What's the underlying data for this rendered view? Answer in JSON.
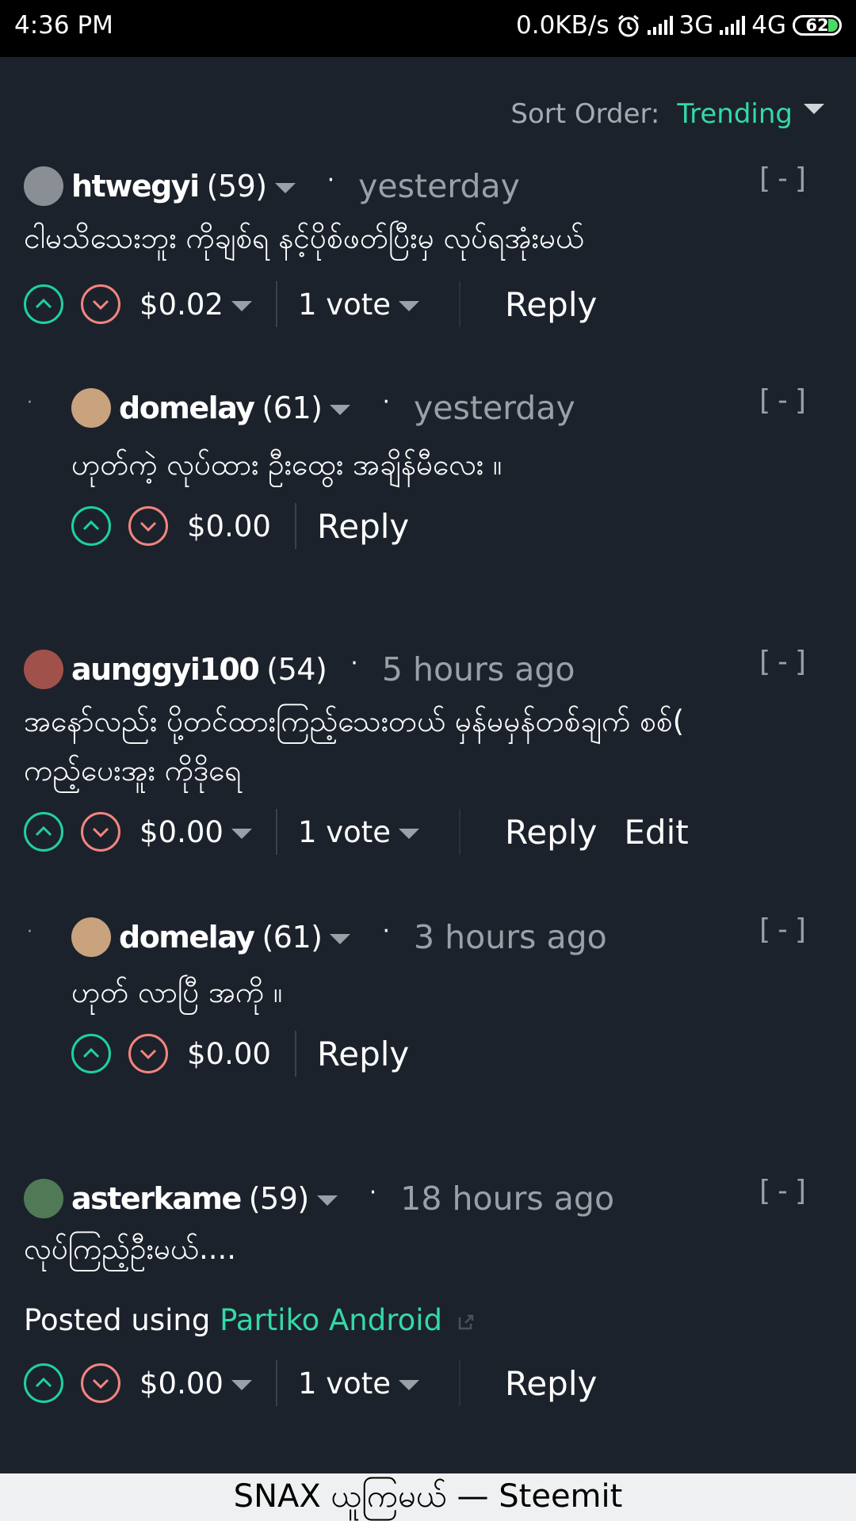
{
  "status_bar": {
    "time": "4:36 PM",
    "net_speed": "0.0KB/s",
    "network_1": "3G",
    "network_2": "4G",
    "battery": "62",
    "alarm_icon": "alarm-clock-icon"
  },
  "sort": {
    "label": "Sort Order:",
    "value": "Trending"
  },
  "comments": [
    {
      "author": "htwegyi",
      "reputation": "(59)",
      "time": "yesterday",
      "collapse": "[-]",
      "body": [
        "ငါမသိသေးဘူး ကိုချစ်ရ နင့်ပိုစ်ဖတ်ပြီးမှ လုပ်ရအုံးမယ်"
      ],
      "payout": "$0.02",
      "votes": "1 vote",
      "reply": "Reply",
      "avatar_color": "#8a8f95"
    },
    {
      "author": "domelay",
      "reputation": "(61)",
      "time": "yesterday",
      "collapse": "[-]",
      "thread_marker": "·",
      "body": [
        "ဟုတ်ကဲ့ လုပ်ထား ဦးထွေး အချိန်မီလေး ။"
      ],
      "payout": "$0.00",
      "reply": "Reply",
      "avatar_color": "#c9a27e"
    },
    {
      "author": "aunggyi100",
      "reputation": "(54)",
      "time": "5 hours ago",
      "collapse": "[-]",
      "body": [
        "အနော်လည်း ပို့တင်ထားကြည့်သေးတယ် မှန်မမှန်တစ်ချက် စစ်(",
        "ကည့်ပေးအူး ကိုဒိုရေ"
      ],
      "payout": "$0.00",
      "votes": "1 vote",
      "reply": "Reply",
      "edit": "Edit",
      "avatar_color": "#a0514a"
    },
    {
      "author": "domelay",
      "reputation": "(61)",
      "time": "3 hours ago",
      "collapse": "[-]",
      "thread_marker": "·",
      "body": [
        "ဟုတ် လာပြီ အကို ။"
      ],
      "payout": "$0.00",
      "reply": "Reply",
      "avatar_color": "#c9a27e"
    },
    {
      "author": "asterkame",
      "reputation": "(59)",
      "time": "18 hours ago",
      "collapse": "[-]",
      "body": [
        "လုပ်ကြည့်ဦးမယ်...."
      ],
      "posted_using": "Posted using",
      "posted_link": "Partiko Android",
      "payout": "$0.00",
      "votes": "1 vote",
      "reply": "Reply",
      "avatar_color": "#4f7a55"
    }
  ],
  "footer": {
    "title": "SNAX ယူကြမယ် — Steemit"
  },
  "colors": {
    "background": "#1c222b",
    "accent": "#33d9a6",
    "upvote": "#1fd1a0",
    "downvote": "#f2857f",
    "muted": "#9aa0a8"
  }
}
